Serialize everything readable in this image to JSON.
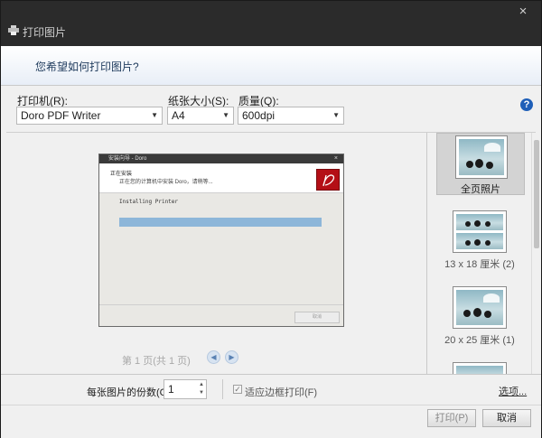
{
  "window": {
    "title": "打印图片",
    "close_glyph": "×"
  },
  "header": {
    "question": "您希望如何打印图片?"
  },
  "printer": {
    "label": "打印机(R):",
    "value": "Doro PDF Writer"
  },
  "paper": {
    "label": "纸张大小(S):",
    "value": "A4"
  },
  "quality": {
    "label": "质量(Q):",
    "value": "600dpi"
  },
  "help_glyph": "?",
  "preview_window": {
    "title": "安装向导 - Doro",
    "heading": "正在安装",
    "subheading": "正在您的计算机中安装 Doro，请稍等...",
    "status": "Installing Printer",
    "button": "取消",
    "progress": 1.0
  },
  "pager": {
    "text": "第 1 页(共 1 页)",
    "prev": "◀",
    "next": "▶"
  },
  "layouts": [
    {
      "label": "全页照片",
      "selected": true
    },
    {
      "label": "13 x 18 厘米 (2)",
      "selected": false
    },
    {
      "label": "20 x 25 厘米 (1)",
      "selected": false
    },
    {
      "label": "",
      "selected": false
    }
  ],
  "copies": {
    "label": "每张图片的份数(C):",
    "value": "1"
  },
  "fit_frame": {
    "label": "适应边框打印(F)",
    "checked": true
  },
  "options_link": "选项...",
  "buttons": {
    "print": "打印(P)",
    "cancel": "取消"
  },
  "colors": {
    "titlebar": "#2b2b2b",
    "progress": "#8db6d9",
    "help": "#1f5fb8",
    "logo": "#b40f16"
  },
  "icons": {
    "title": "printer-icon",
    "help": "help-icon",
    "close": "close-icon"
  }
}
